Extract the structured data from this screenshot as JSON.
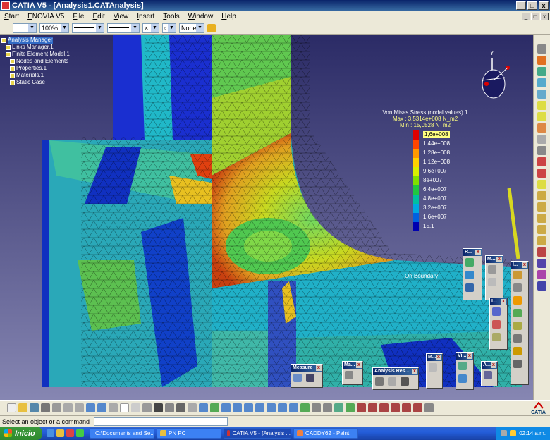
{
  "window": {
    "title": "CATIA V5 - [Analysis1.CATAnalysis]"
  },
  "menu": {
    "items": [
      "Start",
      "ENOVIA V5",
      "File",
      "Edit",
      "View",
      "Insert",
      "Tools",
      "Window",
      "Help"
    ]
  },
  "format_toolbar": {
    "zoom_value": "100%",
    "layer_value": "None"
  },
  "tree": {
    "items": [
      {
        "label": "Analysis Manager",
        "indent": 0,
        "selected": true
      },
      {
        "label": "Links Manager.1",
        "indent": 1
      },
      {
        "label": "Finite Element Model.1",
        "indent": 1
      },
      {
        "label": "Nodes and Elements",
        "indent": 2
      },
      {
        "label": "Properties.1",
        "indent": 2
      },
      {
        "label": "Materials.1",
        "indent": 2
      },
      {
        "label": "Static Case",
        "indent": 2
      }
    ]
  },
  "compass": {
    "axis_label": "Y"
  },
  "legend": {
    "title": "Von Mises Stress (nodal values).1",
    "max": "Max : 3,5314e+008 N_m2",
    "min": "Min : 15,0528 N_m2",
    "levels": [
      {
        "label": "1,6e+008",
        "color": "#e00000",
        "highlight": true
      },
      {
        "label": "1,44e+008",
        "color": "#ff4500"
      },
      {
        "label": "1,28e+008",
        "color": "#ff9900"
      },
      {
        "label": "1,12e+008",
        "color": "#ffd200"
      },
      {
        "label": "9,6e+007",
        "color": "#d8f000"
      },
      {
        "label": "8e+007",
        "color": "#80e000"
      },
      {
        "label": "6,4e+007",
        "color": "#20c840"
      },
      {
        "label": "4,8e+007",
        "color": "#00c0a0"
      },
      {
        "label": "3,2e+007",
        "color": "#00a8e0"
      },
      {
        "label": "1,6e+007",
        "color": "#0060e0"
      },
      {
        "label": "15,1",
        "color": "#0000b0"
      }
    ],
    "footer": "On Boundary"
  },
  "floating_toolbars": {
    "measure": "Measure",
    "ma": "Ma...",
    "analysis_results": "Analysis Res...",
    "m1": "M...",
    "vi": "Vi...",
    "a": "A...",
    "r": "R...",
    "m2": "M...",
    "i1": "I...",
    "i2": "I..."
  },
  "catia_logo": "CATIA",
  "status": {
    "prompt": "Select an object or a command"
  },
  "taskbar": {
    "start_label": "Inicio",
    "tasks": [
      {
        "label": "C:\\Documents and Se...",
        "active": false
      },
      {
        "label": "PN PC",
        "active": false
      },
      {
        "label": "CATIA V5 - [Analysis ...",
        "active": true
      },
      {
        "label": "CADDY62 - Paint",
        "active": false
      }
    ],
    "clock": "02:14 a.m."
  }
}
